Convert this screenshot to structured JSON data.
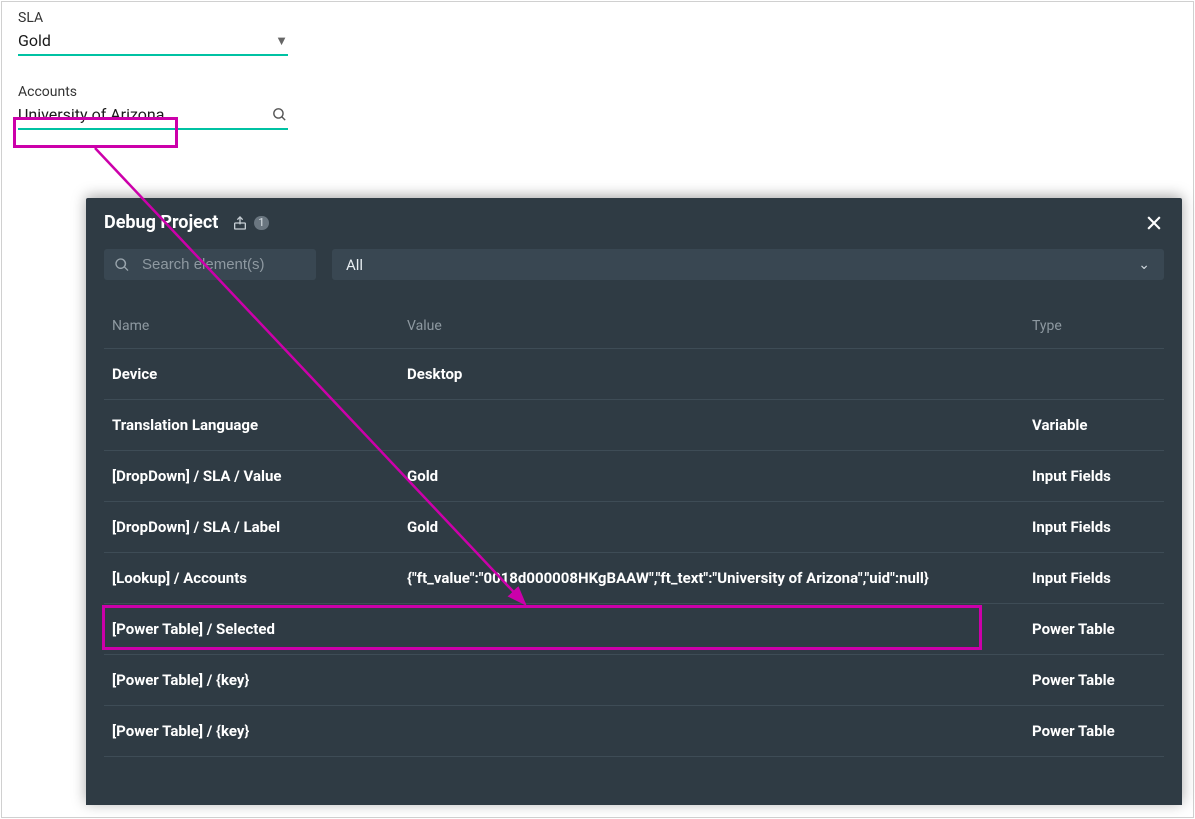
{
  "form": {
    "sla": {
      "label": "SLA",
      "value": "Gold"
    },
    "accounts": {
      "label": "Accounts",
      "value": "University of Arizona"
    }
  },
  "debug_panel": {
    "title": "Debug Project",
    "badge": "1",
    "search_placeholder": "Search element(s)",
    "filter_value": "All",
    "columns": {
      "name": "Name",
      "value": "Value",
      "type": "Type"
    },
    "rows": [
      {
        "name": "Device",
        "value": "Desktop",
        "type": ""
      },
      {
        "name": "Translation Language",
        "value": "",
        "type": "Variable"
      },
      {
        "name": "[DropDown]  / SLA / Value",
        "value": "Gold",
        "type": "Input Fields"
      },
      {
        "name": "[DropDown]  / SLA / Label",
        "value": "Gold",
        "type": "Input Fields"
      },
      {
        "name": "[Lookup]  / Accounts",
        "value": "{\"ft_value\":\"0018d000008HKgBAAW\",\"ft_text\":\"University of Arizona\",\"uid\":null}",
        "type": "Input Fields"
      },
      {
        "name": "[Power Table] / Selected",
        "value": "",
        "type": "Power Table"
      },
      {
        "name": "[Power Table] / {key}",
        "value": "",
        "type": "Power Table"
      },
      {
        "name": "[Power Table] / {key}",
        "value": "",
        "type": "Power Table"
      }
    ]
  }
}
